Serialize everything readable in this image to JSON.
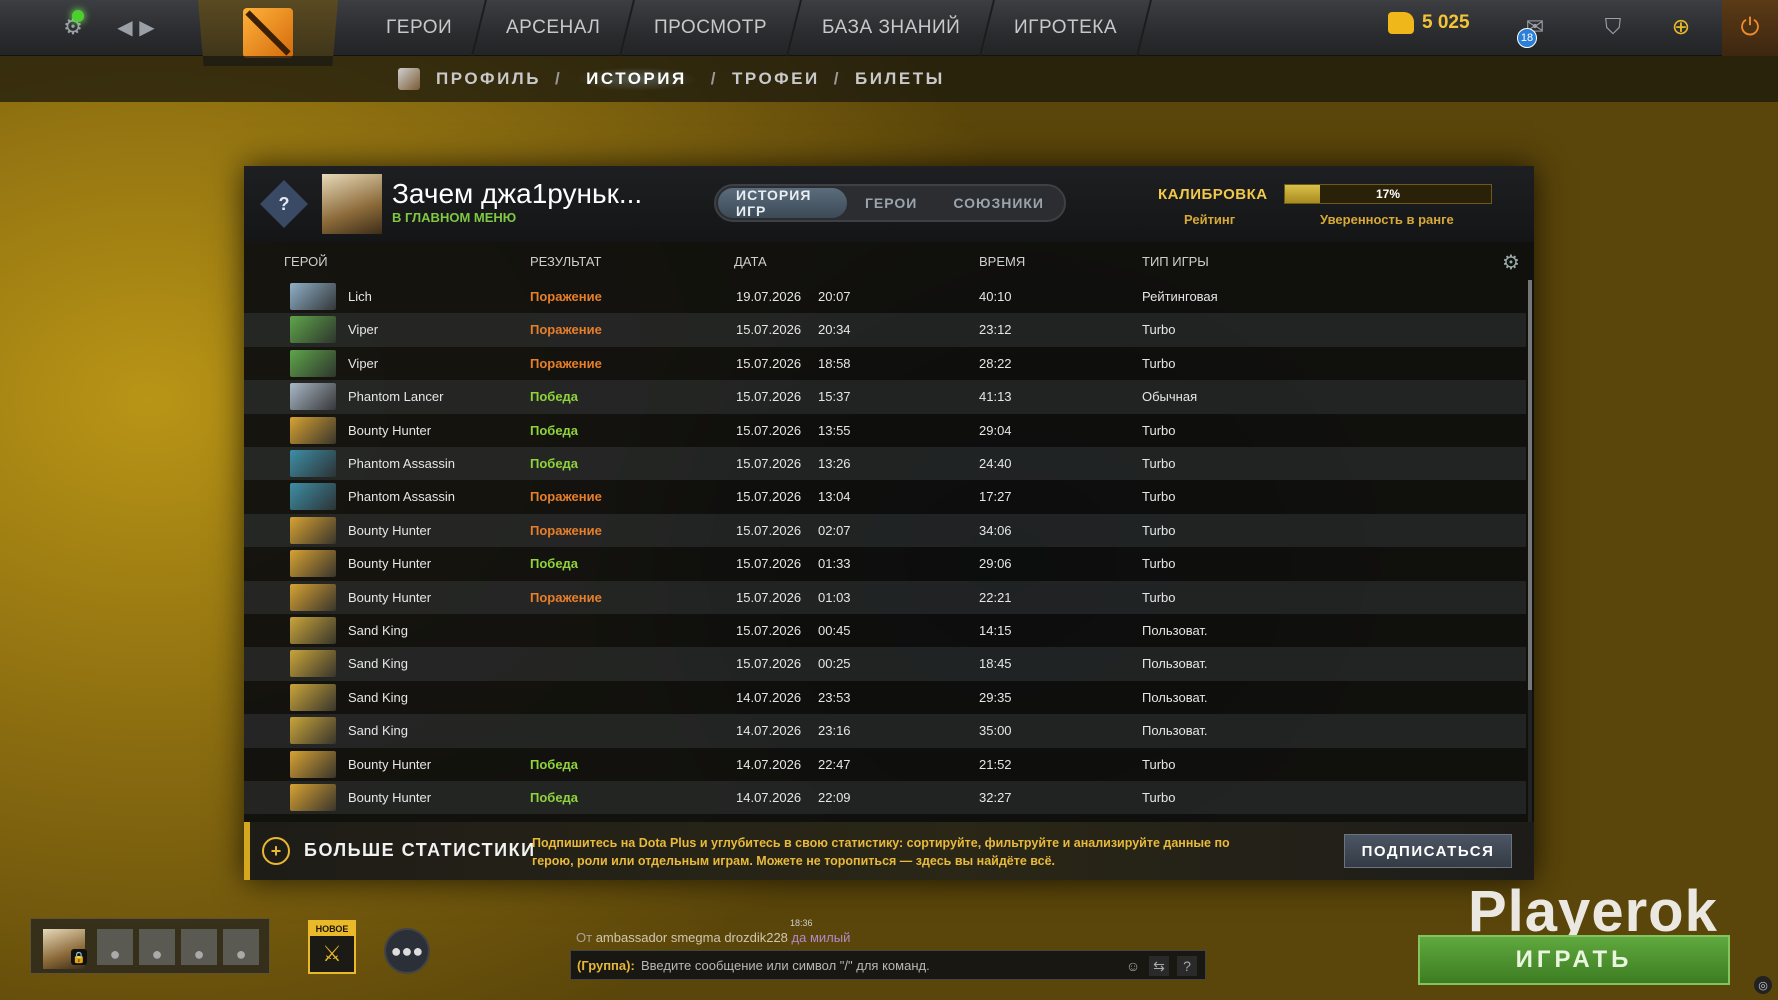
{
  "topbar": {
    "nav": [
      "ГЕРОИ",
      "АРСЕНАЛ",
      "ПРОСМОТР",
      "БАЗА ЗНАНИЙ",
      "ИГРОТЕКА"
    ],
    "gold": "5 025",
    "mail_count": "18"
  },
  "breadcrumb": {
    "items": [
      "ПРОФИЛЬ",
      "ИСТОРИЯ",
      "ТРОФЕИ",
      "БИЛЕТЫ"
    ],
    "separator": "/"
  },
  "profile": {
    "name": "Зачем джа1руньк...",
    "status": "В ГЛАВНОМ МЕНЮ",
    "rank_badge": "?",
    "tabs": [
      "ИСТОРИЯ ИГР",
      "ГЕРОИ",
      "СОЮЗНИКИ"
    ],
    "calibration_label": "КАЛИБРОВКА",
    "rating_label": "Рейтинг",
    "confidence_value": "17%",
    "confidence_fraction": 0.17,
    "confidence_label": "Уверенность в ранге"
  },
  "columns": {
    "hero": "ГЕРОЙ",
    "result": "РЕЗУЛЬТАТ",
    "date": "ДАТА",
    "duration": "ВРЕМЯ",
    "game_type": "ТИП ИГРЫ"
  },
  "matches": [
    {
      "hero": "Lich",
      "result": "Поражение",
      "win": false,
      "date": "19.07.2026",
      "time": "20:07",
      "duration": "40:10",
      "type": "Рейтинговая",
      "color": "#8fb0c8"
    },
    {
      "hero": "Viper",
      "result": "Поражение",
      "win": false,
      "date": "15.07.2026",
      "time": "20:34",
      "duration": "23:12",
      "type": "Turbo",
      "color": "#5ea54a"
    },
    {
      "hero": "Viper",
      "result": "Поражение",
      "win": false,
      "date": "15.07.2026",
      "time": "18:58",
      "duration": "28:22",
      "type": "Turbo",
      "color": "#5ea54a"
    },
    {
      "hero": "Phantom Lancer",
      "result": "Победа",
      "win": true,
      "date": "15.07.2026",
      "time": "15:37",
      "duration": "41:13",
      "type": "Обычная",
      "color": "#a9b8c6"
    },
    {
      "hero": "Bounty Hunter",
      "result": "Победа",
      "win": true,
      "date": "15.07.2026",
      "time": "13:55",
      "duration": "29:04",
      "type": "Turbo",
      "color": "#d7a233"
    },
    {
      "hero": "Phantom Assassin",
      "result": "Победа",
      "win": true,
      "date": "15.07.2026",
      "time": "13:26",
      "duration": "24:40",
      "type": "Turbo",
      "color": "#3e8ea6"
    },
    {
      "hero": "Phantom Assassin",
      "result": "Поражение",
      "win": false,
      "date": "15.07.2026",
      "time": "13:04",
      "duration": "17:27",
      "type": "Turbo",
      "color": "#3e8ea6"
    },
    {
      "hero": "Bounty Hunter",
      "result": "Поражение",
      "win": false,
      "date": "15.07.2026",
      "time": "02:07",
      "duration": "34:06",
      "type": "Turbo",
      "color": "#d7a233"
    },
    {
      "hero": "Bounty Hunter",
      "result": "Победа",
      "win": true,
      "date": "15.07.2026",
      "time": "01:33",
      "duration": "29:06",
      "type": "Turbo",
      "color": "#d7a233"
    },
    {
      "hero": "Bounty Hunter",
      "result": "Поражение",
      "win": false,
      "date": "15.07.2026",
      "time": "01:03",
      "duration": "22:21",
      "type": "Turbo",
      "color": "#d7a233"
    },
    {
      "hero": "Sand King",
      "result": "",
      "win": null,
      "date": "15.07.2026",
      "time": "00:45",
      "duration": "14:15",
      "type": "Пользоват.",
      "color": "#c9a53a"
    },
    {
      "hero": "Sand King",
      "result": "",
      "win": null,
      "date": "15.07.2026",
      "time": "00:25",
      "duration": "18:45",
      "type": "Пользоват.",
      "color": "#c9a53a"
    },
    {
      "hero": "Sand King",
      "result": "",
      "win": null,
      "date": "14.07.2026",
      "time": "23:53",
      "duration": "29:35",
      "type": "Пользоват.",
      "color": "#c9a53a"
    },
    {
      "hero": "Sand King",
      "result": "",
      "win": null,
      "date": "14.07.2026",
      "time": "23:16",
      "duration": "35:00",
      "type": "Пользоват.",
      "color": "#c9a53a"
    },
    {
      "hero": "Bounty Hunter",
      "result": "Победа",
      "win": true,
      "date": "14.07.2026",
      "time": "22:47",
      "duration": "21:52",
      "type": "Turbo",
      "color": "#d7a233"
    },
    {
      "hero": "Bounty Hunter",
      "result": "Победа",
      "win": true,
      "date": "14.07.2026",
      "time": "22:09",
      "duration": "32:27",
      "type": "Turbo",
      "color": "#d7a233"
    }
  ],
  "plus_banner": {
    "title": "БОЛЬШЕ СТАТИСТИКИ",
    "text": "Подпишитесь на Dota Plus и углубитесь в свою статистику: сортируйте, фильтруйте и анализируйте данные по герою, роли или отдельным играм. Можете не торопиться — здесь вы найдёте всё.",
    "button": "ПОДПИСАТЬСЯ"
  },
  "bottom": {
    "new_tag": "НОВОЕ",
    "chat_time": "18:36",
    "chat_from": "От",
    "chat_sender": "ambassador smegma drozdik228",
    "chat_message": "да милый",
    "chat_channel": "(Группа):",
    "chat_placeholder": "Введите сообщение или символ \"/\" для команд.",
    "watermark": "Playerok",
    "play_button": "ИГРАТЬ"
  },
  "colors": {
    "win": "#8fd33b",
    "loss": "#e77f2a",
    "accent_gold": "#e9b92a",
    "play_green": "#4f9a33"
  }
}
